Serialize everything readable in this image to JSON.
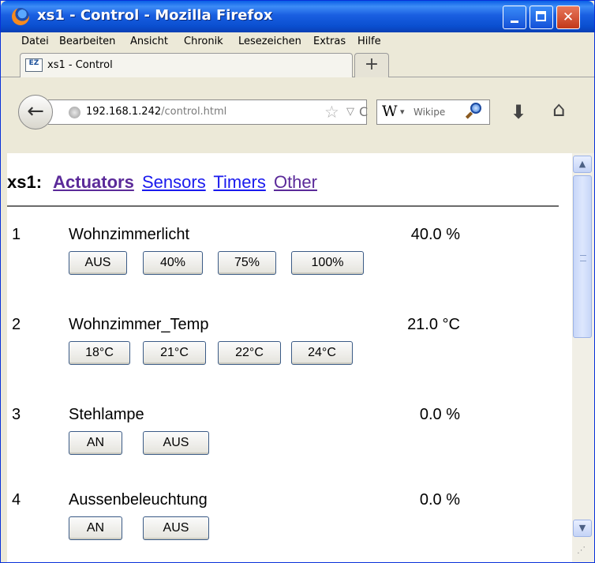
{
  "window": {
    "title": "xs1 - Control - Mozilla Firefox",
    "min_glyph": "",
    "max_glyph": "",
    "close_glyph": "✕"
  },
  "menu": [
    "Datei",
    "Bearbeiten",
    "Ansicht",
    "Chronik",
    "Lesezeichen",
    "Extras",
    "Hilfe"
  ],
  "tab": {
    "favicon_text": "EZ",
    "label": "xs1 - Control",
    "new_tab_glyph": "+"
  },
  "navbar": {
    "back_glyph": "←",
    "url_host": "192.168.1.242",
    "url_path": "/control.html",
    "star_glyph": "☆",
    "dropdown_glyph": "▽",
    "reload_glyph": "C",
    "search_engine_glyph": "W",
    "search_dropdown_glyph": "▾",
    "search_placeholder": "Wikipe",
    "download_glyph": "⬇",
    "home_glyph": "⌂"
  },
  "page": {
    "site_name": "xs1:",
    "nav": [
      "Actuators",
      "Sensors",
      "Timers",
      "Other"
    ]
  },
  "actuators": [
    {
      "num": "1",
      "name": "Wohnzimmerlicht",
      "value": "40.0 %",
      "buttons": [
        "AUS",
        "40%",
        "75%",
        "100%"
      ]
    },
    {
      "num": "2",
      "name": "Wohnzimmer_Temp",
      "value": "21.0 °C",
      "buttons": [
        "18°C",
        "21°C",
        "22°C",
        "24°C"
      ]
    },
    {
      "num": "3",
      "name": "Stehlampe",
      "value": "0.0 %",
      "buttons": [
        "AN",
        "AUS"
      ]
    },
    {
      "num": "4",
      "name": "Aussenbeleuchtung",
      "value": "0.0 %",
      "buttons": [
        "AN",
        "AUS"
      ]
    }
  ],
  "scrollbar": {
    "up_glyph": "▲",
    "down_glyph": "▼",
    "grip_glyph": "⋰"
  },
  "colors": {
    "link": "#1a1aee",
    "link_active": "#5b2a99",
    "titlebar": "#0a4fd0"
  }
}
